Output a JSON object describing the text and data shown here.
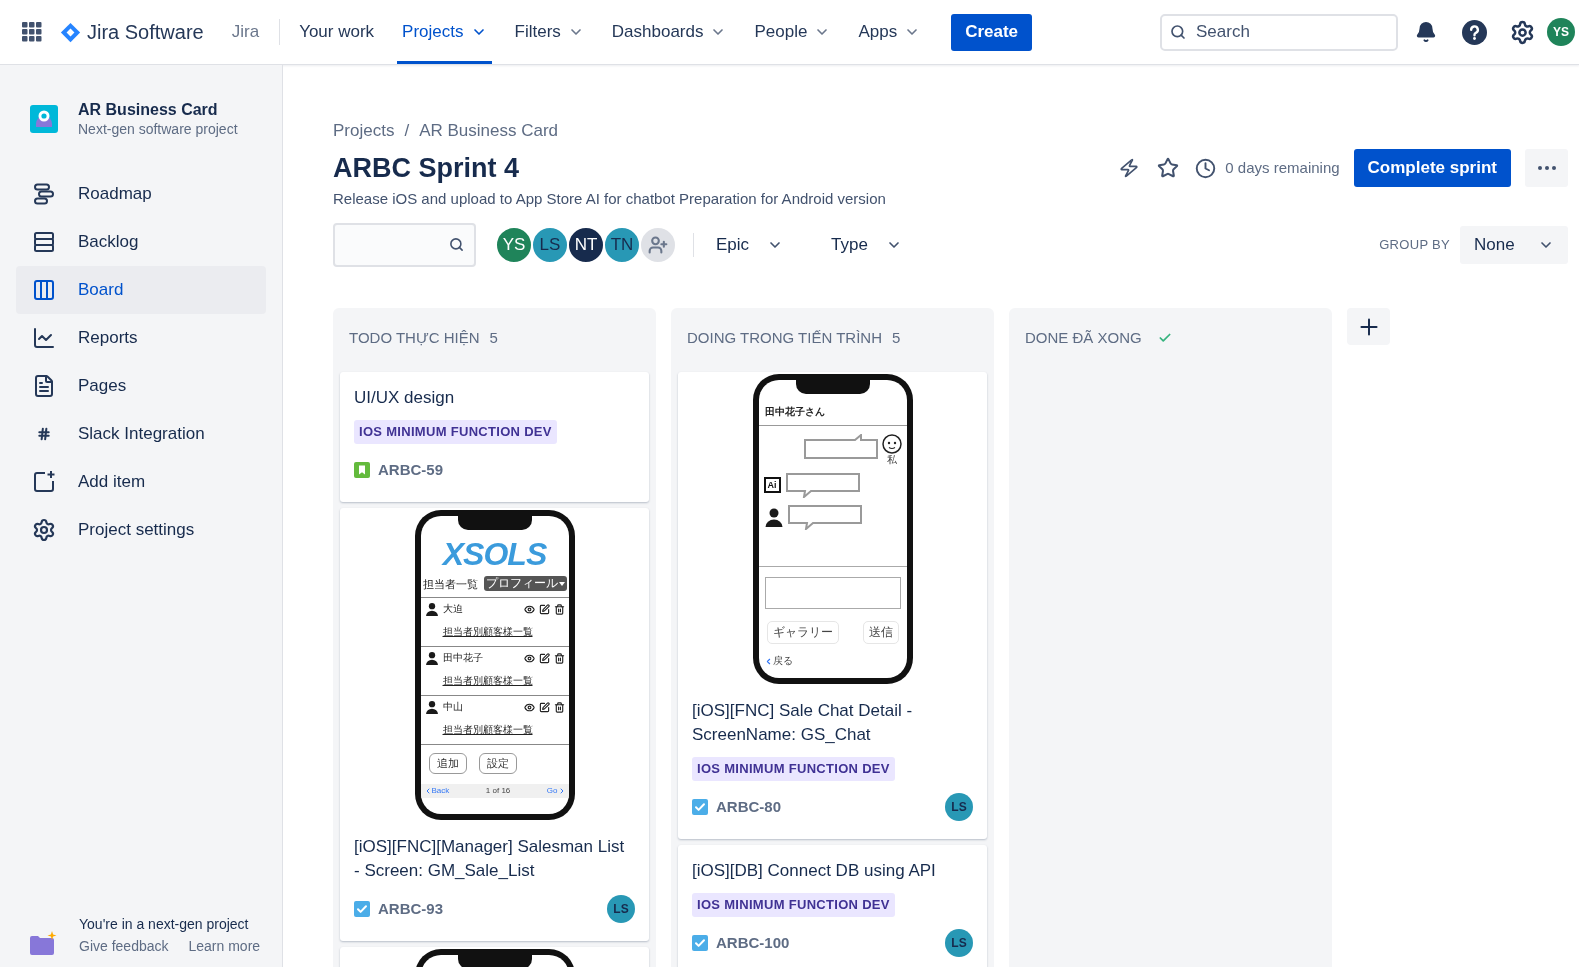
{
  "topnav": {
    "product": "Jira Software",
    "site": "Jira",
    "items": [
      {
        "label": "Your work",
        "selected": false,
        "dropdown": false
      },
      {
        "label": "Projects",
        "selected": true,
        "dropdown": true
      },
      {
        "label": "Filters",
        "selected": false,
        "dropdown": true
      },
      {
        "label": "Dashboards",
        "selected": false,
        "dropdown": true
      },
      {
        "label": "People",
        "selected": false,
        "dropdown": true
      },
      {
        "label": "Apps",
        "selected": false,
        "dropdown": true
      }
    ],
    "create": "Create",
    "search": {
      "placeholder": "Search"
    },
    "avatar": "YS"
  },
  "sidebar": {
    "project": {
      "name": "AR Business Card",
      "type": "Next-gen software project"
    },
    "items": [
      {
        "label": "Roadmap",
        "selected": false
      },
      {
        "label": "Backlog",
        "selected": false
      },
      {
        "label": "Board",
        "selected": true
      },
      {
        "label": "Reports",
        "selected": false
      },
      {
        "label": "Pages",
        "selected": false
      },
      {
        "label": "Slack Integration",
        "selected": false
      },
      {
        "label": "Add item",
        "selected": false
      },
      {
        "label": "Project settings",
        "selected": false
      }
    ],
    "footer": {
      "text": "You're in a next-gen project",
      "links": [
        "Give feedback",
        "Learn more"
      ]
    }
  },
  "header": {
    "breadcrumbs": {
      "items": [
        "Projects",
        "AR Business Card"
      ],
      "separator": "/"
    },
    "title": "ARBC Sprint 4",
    "description": "Release iOS and upload to App Store AI for chatbot Preparation for Android version",
    "remaining": "0 days remaining",
    "complete_button": "Complete sprint"
  },
  "filters": {
    "avatars": [
      {
        "initials": "YS",
        "color": "#1f845a"
      },
      {
        "initials": "LS",
        "color": "#2898b5"
      },
      {
        "initials": "NT",
        "color": "#172b4d"
      },
      {
        "initials": "TN",
        "color": "#2898b5"
      }
    ],
    "dropdowns": [
      "Epic",
      "Type"
    ],
    "group_by": {
      "label": "GROUP BY",
      "value": "None"
    }
  },
  "columns": [
    {
      "title": "TODO THỰC HIỆN",
      "count": "5",
      "done": false,
      "cards": [
        {
          "title": "UI/UX design",
          "epic": "IOS MINIMUM FUNCTION DEV",
          "kind": "story",
          "key": "ARBC-59"
        },
        {
          "cover": {
            "kind": "list",
            "logo": "XSOLS",
            "heading": "担当者一覧",
            "menu": "プロフィール",
            "rows": [
              {
                "name": "大迫",
                "link": "担当者別顧客様一覧"
              },
              {
                "name": "田中花子",
                "link": "担当者別顧客様一覧"
              },
              {
                "name": "中山",
                "link": "担当者別顧客様一覧"
              }
            ],
            "buttons": [
              "追加",
              "設定"
            ],
            "back": "Back",
            "page": "1 of 16",
            "next": "Go"
          },
          "title": "[iOS][FNC][Manager] Salesman List - Screen: GM_Sale_List",
          "kind": "task",
          "key": "ARBC-93",
          "assignee": "LS"
        },
        {
          "cover": {
            "kind": "phone"
          }
        }
      ]
    },
    {
      "title": "DOING TRONG TIẾN TRÌNH",
      "count": "5",
      "done": false,
      "cards": [
        {
          "cover": {
            "kind": "chat",
            "contact": "田中花子さん",
            "me": "私",
            "bot": "Ai",
            "buttons": [
              "ギャラリー",
              "送信"
            ],
            "back": "戻る"
          },
          "title": "[iOS][FNC] Sale Chat Detail - ScreenName: GS_Chat",
          "epic": "IOS MINIMUM FUNCTION DEV",
          "kind": "task",
          "key": "ARBC-80",
          "assignee": "LS"
        },
        {
          "title": "[iOS][DB] Connect DB using API",
          "epic": "IOS MINIMUM FUNCTION DEV",
          "kind": "task",
          "key": "ARBC-100",
          "assignee": "LS"
        }
      ]
    },
    {
      "title": "DONE ĐÃ XONG",
      "done": true
    }
  ]
}
